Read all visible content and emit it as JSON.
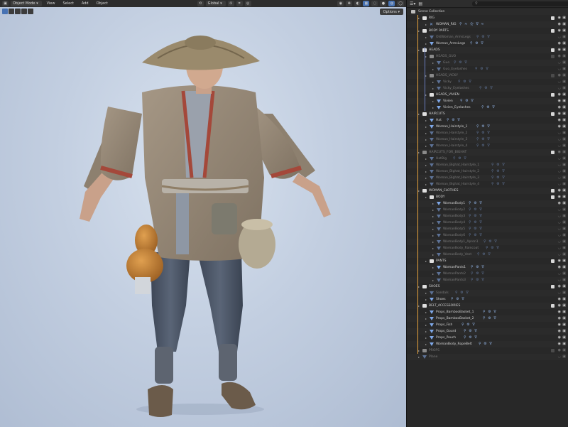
{
  "header": {
    "mode": "Object Mode",
    "menus": [
      "View",
      "Select",
      "Add",
      "Object"
    ],
    "orientation": "Global",
    "options_label": "Options"
  },
  "outliner": {
    "search_icon": "search-icon",
    "root": "Scene Collection",
    "rows": [
      {
        "label": "RIG",
        "kind": "collection",
        "level": 1,
        "check": true
      },
      {
        "label": "WOMAN_RIG",
        "kind": "armature",
        "level": 2,
        "mods": "⚲ ≈ ⚝ ∇ ≈"
      },
      {
        "label": "BODY PARTS",
        "kind": "collection",
        "level": 1,
        "check": true
      },
      {
        "label": "OldWoman_ArmsLegs",
        "kind": "mesh",
        "level": 2,
        "mods": "⚲ ⚙ ∇",
        "dim": true
      },
      {
        "label": "Woman_ArmsLegs",
        "kind": "mesh",
        "level": 2,
        "mods": "⚲ ⚙ ∇"
      },
      {
        "label": "HEADS",
        "kind": "collection",
        "level": 1,
        "check": true
      },
      {
        "label": "HEADS_GUO",
        "kind": "collection",
        "level": 2,
        "dim": true,
        "check": false
      },
      {
        "label": "Guo",
        "kind": "mesh",
        "level": 3,
        "mods": "⚲ ⚙ ∇",
        "dim": true
      },
      {
        "label": "Guo_Eyelashes",
        "kind": "mesh",
        "level": 3,
        "mods": "⚲ ⚙ ∇",
        "dim": true
      },
      {
        "label": "HEADS_VICKY",
        "kind": "collection",
        "level": 2,
        "dim": true,
        "check": false
      },
      {
        "label": "Vicky",
        "kind": "mesh",
        "level": 3,
        "mods": "⚲ ⚙ ∇",
        "dim": true
      },
      {
        "label": "Vicky_Eyelashes",
        "kind": "mesh",
        "level": 3,
        "mods": "⚲ ⚙ ∇",
        "dim": true
      },
      {
        "label": "HEADS_VIVIEN",
        "kind": "collection",
        "level": 2,
        "check": true
      },
      {
        "label": "Vivien",
        "kind": "mesh",
        "level": 3,
        "mods": "⚲ ⚙ ∇"
      },
      {
        "label": "Vivien_Eyelashes",
        "kind": "mesh",
        "level": 3,
        "mods": "⚲ ⚙ ∇"
      },
      {
        "label": "HAIRCUTS",
        "kind": "collection",
        "level": 1,
        "check": true
      },
      {
        "label": "Hat",
        "kind": "mesh",
        "level": 2,
        "mods": "⚲ ⚙ ∇"
      },
      {
        "label": "Woman_Hairstyle_1",
        "kind": "mesh",
        "level": 2,
        "mods": "⚲ ⚙ ∇"
      },
      {
        "label": "Woman_Hairstyle_2",
        "kind": "mesh",
        "level": 2,
        "mods": "⚲ ⚙ ∇",
        "dim": true
      },
      {
        "label": "Woman_Hairstyle_3",
        "kind": "mesh",
        "level": 2,
        "mods": "⚲ ⚙ ∇",
        "dim": true
      },
      {
        "label": "Woman_Hairstyle_4",
        "kind": "mesh",
        "level": 2,
        "mods": "⚲ ⚙ ∇",
        "dim": true
      },
      {
        "label": "HAIRCUTS_FOR_BIGHAT",
        "kind": "collection",
        "level": 1,
        "dim": true,
        "check": true
      },
      {
        "label": "HatBig",
        "kind": "mesh",
        "level": 2,
        "mods": "⚲ ⚙ ∇",
        "dim": true
      },
      {
        "label": "Woman_Bighat_Hairstyle_1",
        "kind": "mesh",
        "level": 2,
        "mods": "⚲ ⚙ ∇",
        "dim": true
      },
      {
        "label": "Woman_Bighat_Hairstyle_2",
        "kind": "mesh",
        "level": 2,
        "mods": "⚲ ⚙ ∇",
        "dim": true
      },
      {
        "label": "Woman_Bighat_Hairstyle_3",
        "kind": "mesh",
        "level": 2,
        "mods": "⚲ ⚙ ∇",
        "dim": true
      },
      {
        "label": "Woman_Bighat_Hairstyle_4",
        "kind": "mesh",
        "level": 2,
        "mods": "⚲ ⚙ ∇",
        "dim": true
      },
      {
        "label": "WOMAN_CLOTHES",
        "kind": "collection",
        "level": 1,
        "check": true
      },
      {
        "label": "BODY",
        "kind": "collection",
        "level": 2,
        "check": true
      },
      {
        "label": "WomanBody1",
        "kind": "mesh",
        "level": 3,
        "mods": "⚲ ⚙ ∇"
      },
      {
        "label": "WomanBody2",
        "kind": "mesh",
        "level": 3,
        "mods": "⚲ ⚙ ∇",
        "dim": true
      },
      {
        "label": "WomanBody3",
        "kind": "mesh",
        "level": 3,
        "mods": "⚲ ⚙ ∇",
        "dim": true
      },
      {
        "label": "WomanBody4",
        "kind": "mesh",
        "level": 3,
        "mods": "⚲ ⚙ ∇",
        "dim": true
      },
      {
        "label": "WomanBody5",
        "kind": "mesh",
        "level": 3,
        "mods": "⚲ ⚙ ∇",
        "dim": true
      },
      {
        "label": "WomanBody6",
        "kind": "mesh",
        "level": 3,
        "mods": "⚲ ⚙ ∇",
        "dim": true
      },
      {
        "label": "WomanBody1_Apron1",
        "kind": "mesh",
        "level": 3,
        "mods": "⚲ ⚙ ∇",
        "dim": true
      },
      {
        "label": "WomanBody_Raincoat",
        "kind": "mesh",
        "level": 3,
        "mods": "⚲ ⚙ ∇",
        "dim": true
      },
      {
        "label": "WomanBody_Vest",
        "kind": "mesh",
        "level": 3,
        "mods": "⚲ ⚙ ∇",
        "dim": true
      },
      {
        "label": "PANTS",
        "kind": "collection",
        "level": 2,
        "check": true
      },
      {
        "label": "WomanPants1",
        "kind": "mesh",
        "level": 3,
        "mods": "⚲ ⚙ ∇"
      },
      {
        "label": "WomanPants2",
        "kind": "mesh",
        "level": 3,
        "mods": "⚲ ⚙ ∇",
        "dim": true
      },
      {
        "label": "WomanPants3",
        "kind": "mesh",
        "level": 3,
        "mods": "⚲ ⚙ ∇",
        "dim": true
      },
      {
        "label": "SHOES",
        "kind": "collection",
        "level": 1,
        "check": true
      },
      {
        "label": "Sandals",
        "kind": "mesh",
        "level": 2,
        "mods": "⚲ ⚙ ∇",
        "dim": true
      },
      {
        "label": "Shoes",
        "kind": "mesh",
        "level": 2,
        "mods": "⚲ ⚙ ∇"
      },
      {
        "label": "BELT_ACCESSORIES",
        "kind": "collection",
        "level": 1,
        "check": true
      },
      {
        "label": "Props_BambooBasket_1",
        "kind": "mesh",
        "level": 2,
        "mods": "⚲ ⚙ ∇"
      },
      {
        "label": "Props_BambooBasket_2",
        "kind": "mesh",
        "level": 2,
        "mods": "⚲ ⚙ ∇"
      },
      {
        "label": "Props_Fish",
        "kind": "mesh",
        "level": 2,
        "mods": "⚲ ⚙ ∇"
      },
      {
        "label": "Props_Gourd",
        "kind": "mesh",
        "level": 2,
        "mods": "⚲ ⚙ ∇"
      },
      {
        "label": "Props_Pouch",
        "kind": "mesh",
        "level": 2,
        "mods": "⚲ ⚙ ∇"
      },
      {
        "label": "WomanBody_RopeBelt",
        "kind": "mesh",
        "level": 2,
        "mods": "⚲ ⚙ ∇"
      },
      {
        "label": "PROPS",
        "kind": "collection",
        "level": 1,
        "dim": true,
        "check": false
      },
      {
        "label": "Plane",
        "kind": "mesh",
        "level": 1,
        "dim": true
      }
    ]
  },
  "colors": {
    "accent": "#4772b3",
    "collection_line": "#e8a33c",
    "mesh_icon": "#7fa8e8"
  }
}
